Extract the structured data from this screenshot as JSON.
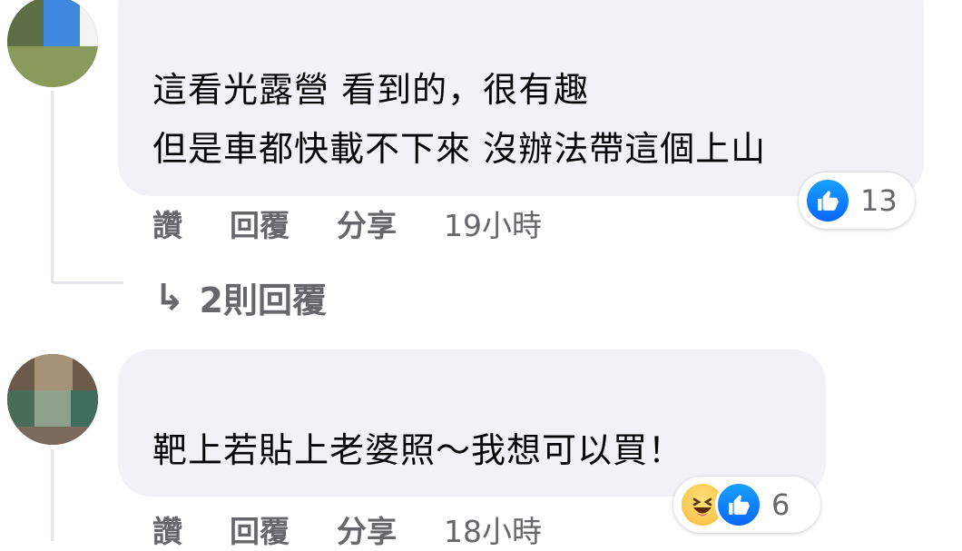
{
  "comments": [
    {
      "text_lines": [
        "這看光露營 看到的，很有趣",
        "但是車都快載不下來 沒辦法帶這個上山"
      ],
      "actions": {
        "like": "讚",
        "reply": "回覆",
        "share": "分享"
      },
      "time": "19小時",
      "reactions": {
        "types": [
          "like-icon"
        ],
        "count": "13"
      },
      "replies_label": "2則回覆"
    },
    {
      "text_lines": [
        "靶上若貼上老婆照～我想可以買！"
      ],
      "actions": {
        "like": "讚",
        "reply": "回覆",
        "share": "分享"
      },
      "time": "18小時",
      "reactions": {
        "types": [
          "haha-icon",
          "like-icon"
        ],
        "count": "6"
      }
    }
  ],
  "colors": {
    "bubble": "#f0f2f5",
    "meta_text": "#65676b",
    "like_blue": "#0866ff",
    "haha_yellow": "#f6b93b"
  }
}
